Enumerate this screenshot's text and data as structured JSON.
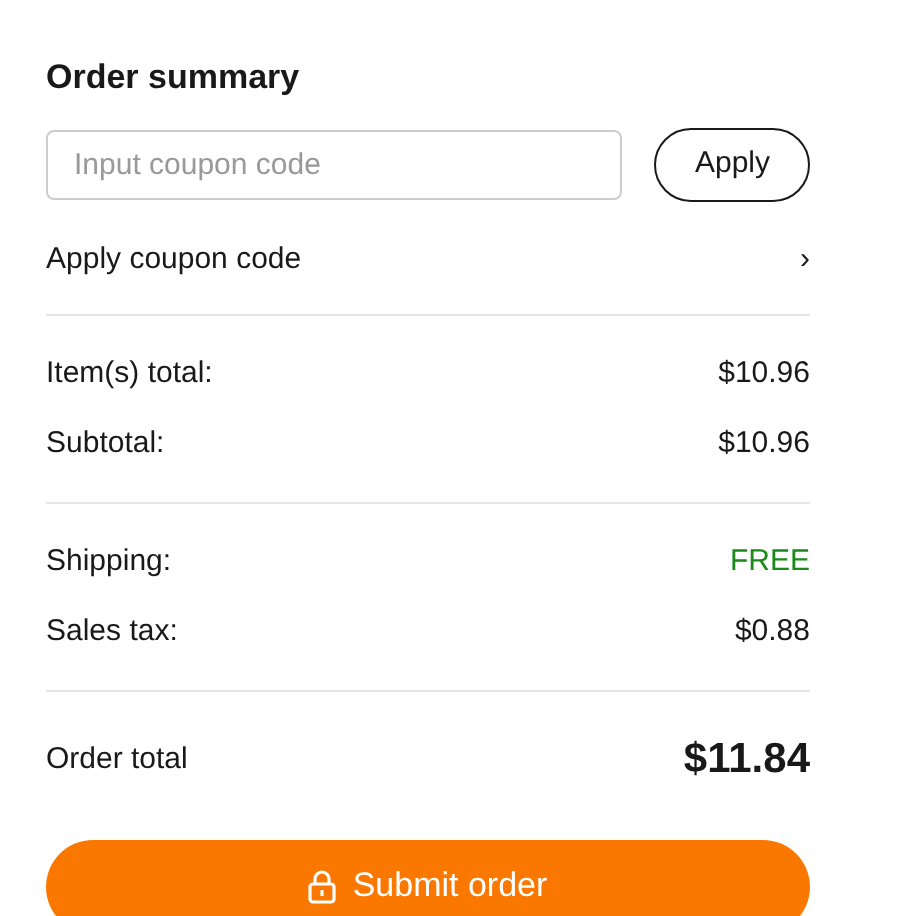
{
  "title": "Order summary",
  "coupon": {
    "placeholder": "Input coupon code",
    "button": "Apply",
    "link": "Apply coupon code",
    "chevron": "›"
  },
  "groups": [
    [
      {
        "label": "Item(s) total:",
        "value": "$10.96",
        "kind": "amount"
      },
      {
        "label": "Subtotal:",
        "value": "$10.96",
        "kind": "amount"
      }
    ],
    [
      {
        "label": "Shipping:",
        "value": "FREE",
        "kind": "free"
      },
      {
        "label": "Sales tax:",
        "value": "$0.88",
        "kind": "amount"
      }
    ]
  ],
  "total": {
    "label": "Order total",
    "value": "$11.84"
  },
  "submit": {
    "label": "Submit order"
  }
}
